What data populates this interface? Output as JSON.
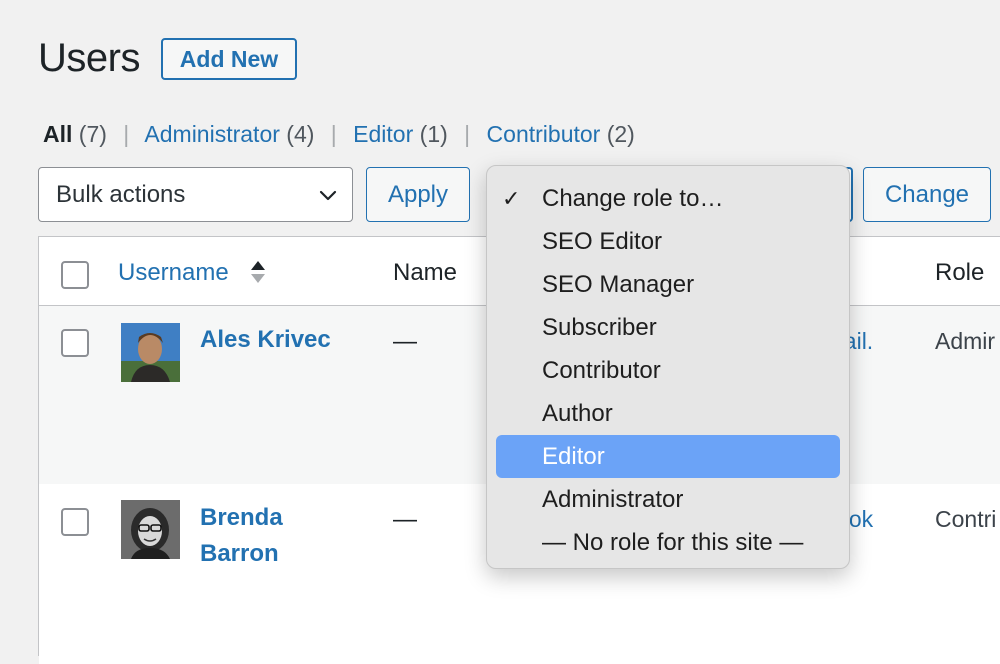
{
  "page": {
    "title": "Users",
    "add_new_label": "Add New"
  },
  "filters": [
    {
      "label": "All",
      "count": "(7)",
      "current": true
    },
    {
      "label": "Administrator",
      "count": "(4)"
    },
    {
      "label": "Editor",
      "count": "(1)"
    },
    {
      "label": "Contributor",
      "count": "(2)"
    }
  ],
  "bulk_actions": {
    "selected": "Bulk actions",
    "apply_label": "Apply"
  },
  "role_change": {
    "change_label": "Change"
  },
  "role_dropdown": {
    "options": [
      {
        "label": "Change role to…",
        "checked": true
      },
      {
        "label": "SEO Editor"
      },
      {
        "label": "SEO Manager"
      },
      {
        "label": "Subscriber"
      },
      {
        "label": "Contributor"
      },
      {
        "label": "Author"
      },
      {
        "label": "Editor",
        "highlighted": true
      },
      {
        "label": "Administrator"
      },
      {
        "label": "— No role for this site —"
      }
    ],
    "checkmark": "✓"
  },
  "table": {
    "columns": {
      "username": "Username",
      "name": "Name",
      "role": "Role"
    },
    "rows": [
      {
        "username": "Ales Krivec",
        "name": "—",
        "email_fragment": "nail.",
        "role": "Admir"
      },
      {
        "username_line1": "Brenda",
        "username_line2": "Barron",
        "name": "—",
        "email_fragment": "stok",
        "role": "Contri"
      }
    ]
  },
  "colors": {
    "accent": "#2271b1",
    "highlight": "#6ba3f7",
    "background": "#f1f1f1"
  }
}
